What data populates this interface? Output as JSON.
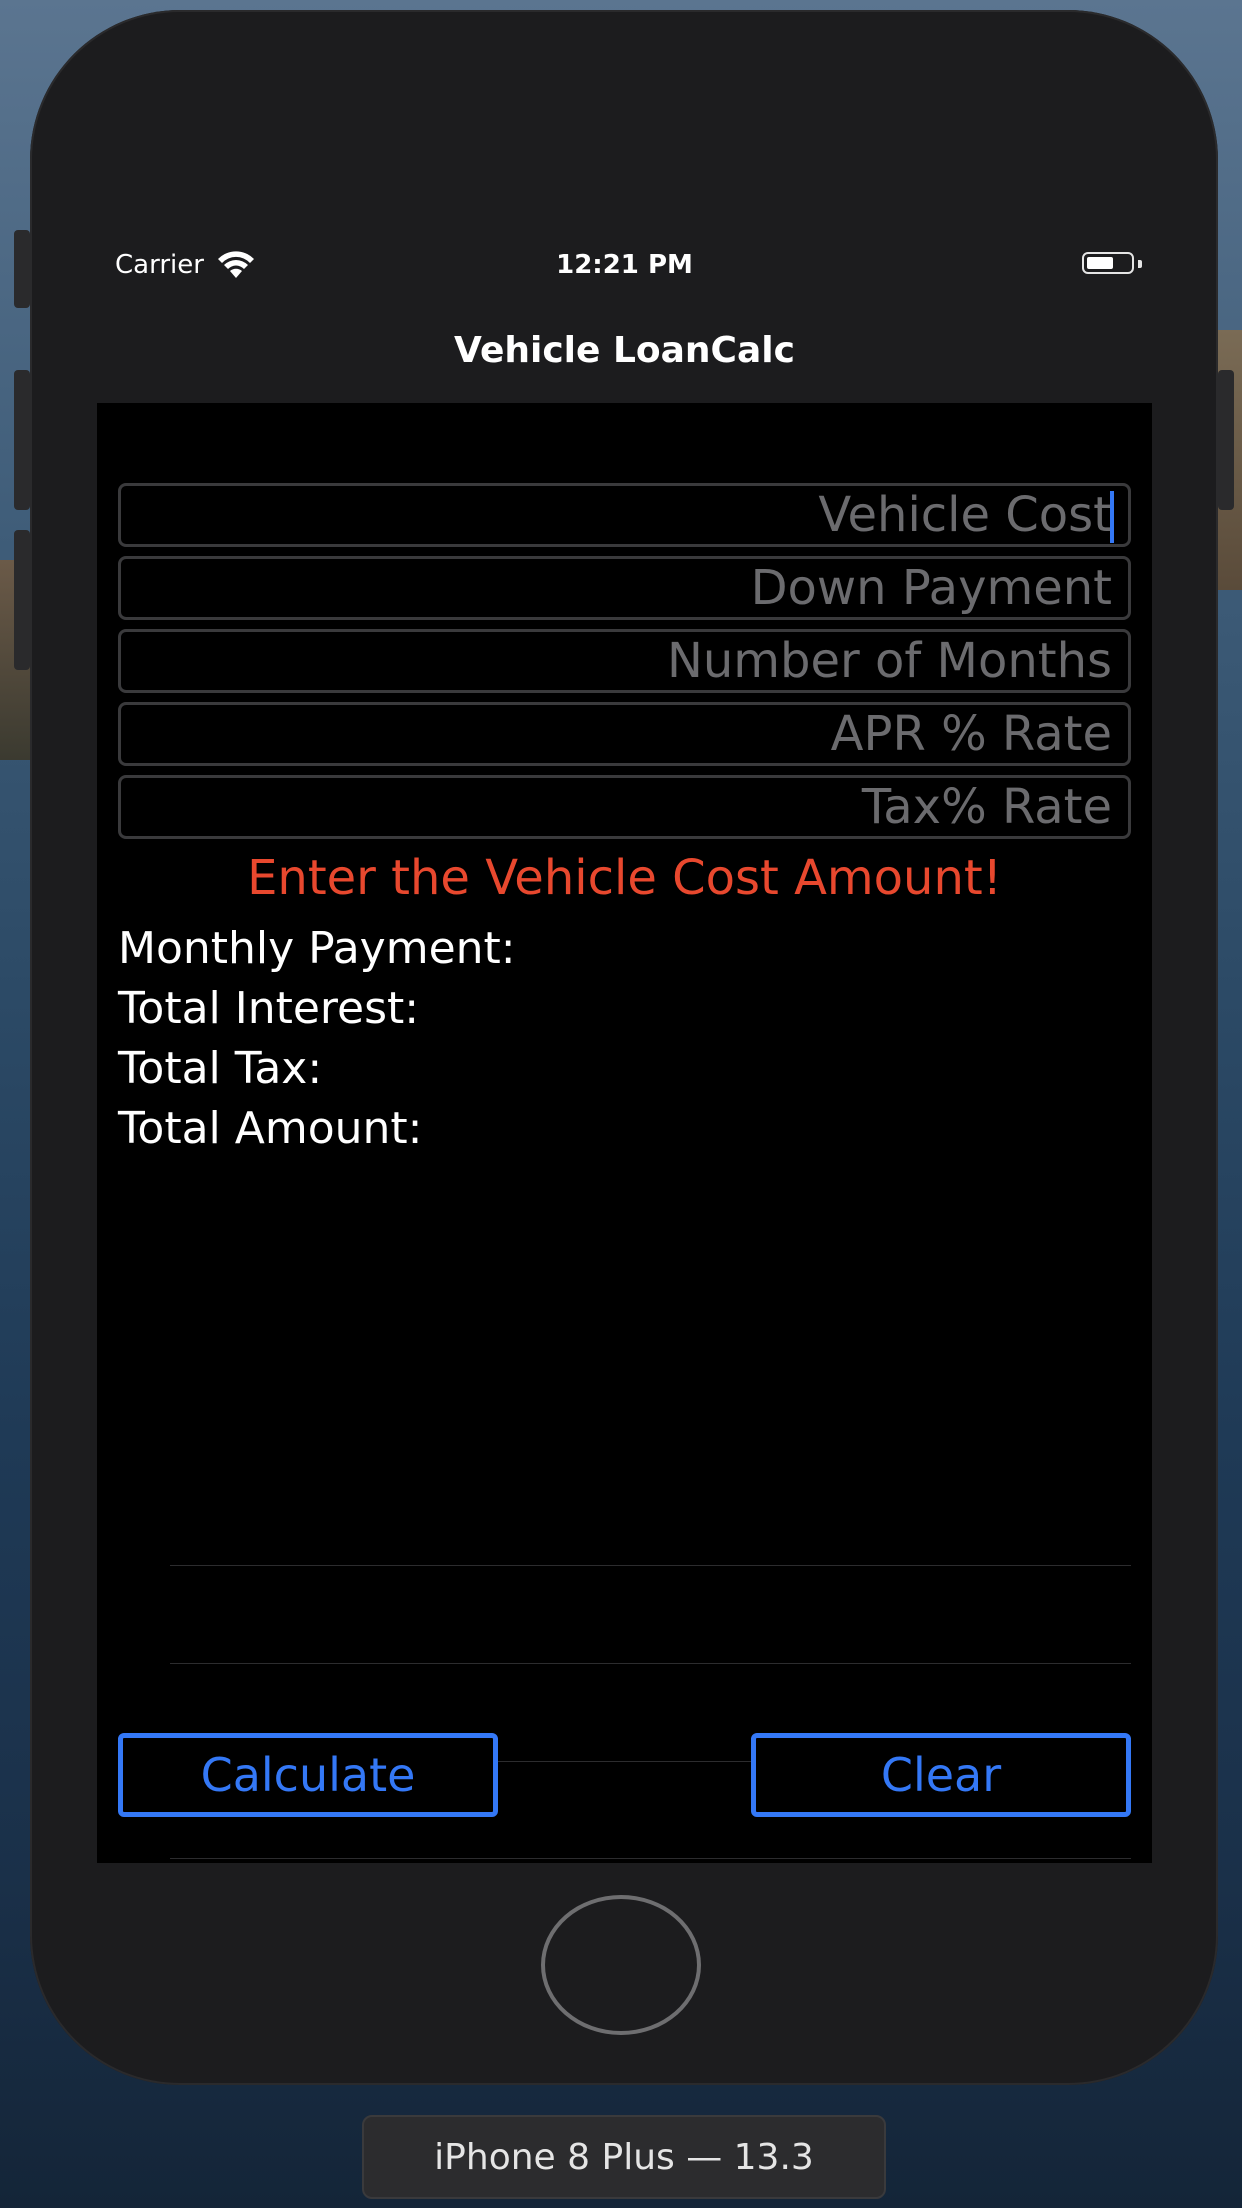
{
  "status_bar": {
    "carrier": "Carrier",
    "time": "12:21 PM"
  },
  "nav": {
    "title": "Vehicle LoanCalc"
  },
  "form": {
    "fields": [
      {
        "placeholder": "Vehicle Cost",
        "value": ""
      },
      {
        "placeholder": "Down Payment",
        "value": ""
      },
      {
        "placeholder": "Number of Months",
        "value": ""
      },
      {
        "placeholder": "APR % Rate",
        "value": ""
      },
      {
        "placeholder": "Tax% Rate",
        "value": ""
      }
    ]
  },
  "error_message": "Enter the Vehicle Cost Amount!",
  "results": {
    "monthly_payment_label": "Monthly Payment:",
    "total_interest_label": "Total Interest:",
    "total_tax_label": "Total Tax:",
    "total_amount_label": "Total Amount:"
  },
  "buttons": {
    "calculate_label": "Calculate",
    "clear_label": "Clear"
  },
  "simulator": {
    "device_label": "iPhone 8 Plus — 13.3"
  },
  "colors": {
    "accent": "#3478f6",
    "error": "#e8482e",
    "background": "#000000",
    "bar": "#1c1c1e"
  },
  "icons": [
    "wifi-icon",
    "battery-icon"
  ]
}
